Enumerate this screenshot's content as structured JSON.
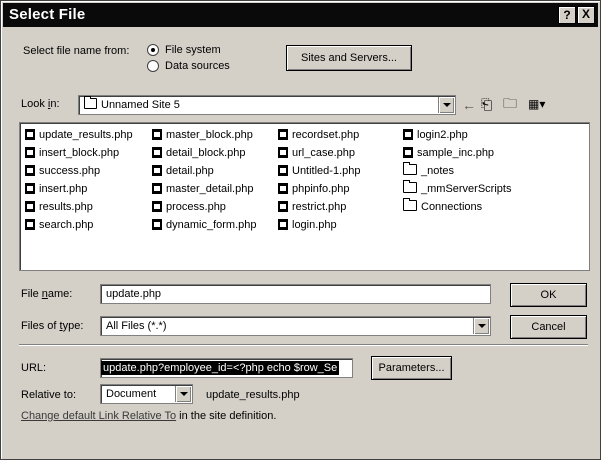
{
  "window": {
    "title": "Select File",
    "help": "?",
    "close": "X"
  },
  "source": {
    "label": "Select file name from:",
    "options": [
      "File system",
      "Data sources"
    ],
    "selected": "File system",
    "sites_button": "Sites and Servers..."
  },
  "lookin": {
    "label_pre": "Look ",
    "label_key": "i",
    "label_post": "n:",
    "value": "Unnamed Site 5"
  },
  "toolbar": [
    "back-arrow-icon",
    "up-folder-icon",
    "new-folder-icon",
    "view-menu-icon"
  ],
  "files": {
    "col1": [
      "update_results.php",
      "insert_block.php",
      "success.php",
      "insert.php",
      "results.php",
      "search.php"
    ],
    "col2": [
      "master_block.php",
      "detail_block.php",
      "detail.php",
      "master_detail.php",
      "process.php",
      "dynamic_form.php"
    ],
    "col3": [
      "recordset.php",
      "url_case.php",
      "Untitled-1.php",
      "phpinfo.php",
      "restrict.php",
      "login.php"
    ],
    "col4": [
      "login2.php",
      "sample_inc.php"
    ],
    "folders": [
      "_notes",
      "_mmServerScripts",
      "Connections"
    ]
  },
  "filename": {
    "label_pre": "File ",
    "label_key": "n",
    "label_post": "ame:",
    "value": "update.php"
  },
  "filetype": {
    "label_pre": "Files of ",
    "label_key": "t",
    "label_post": "ype:",
    "value": "All Files (*.*)"
  },
  "buttons": {
    "ok": "OK",
    "cancel": "Cancel",
    "parameters": "Parameters..."
  },
  "url": {
    "label": "URL:",
    "value": "update.php?employee_id=<?php echo $row_Se"
  },
  "relative": {
    "label": "Relative to:",
    "value": "Document",
    "file": "update_results.php"
  },
  "footer": {
    "link": "Change default Link Relative To",
    "text": " in the site definition."
  }
}
